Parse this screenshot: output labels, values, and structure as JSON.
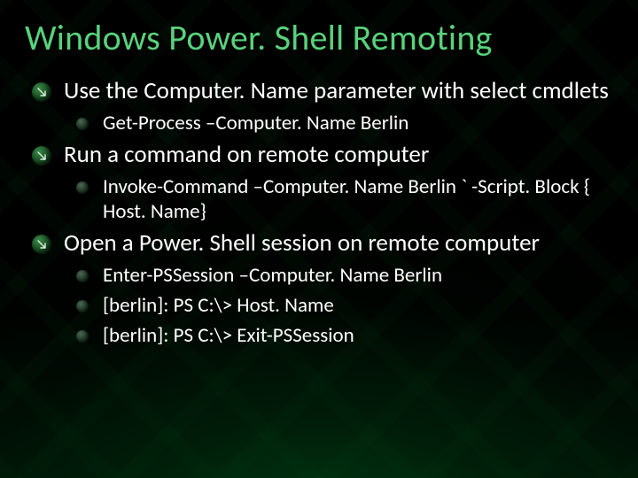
{
  "title": "Windows Power. Shell Remoting",
  "items": [
    {
      "level": 1,
      "text": "Use the Computer. Name parameter with select cmdlets"
    },
    {
      "level": 2,
      "text": "Get-Process –Computer. Name Berlin"
    },
    {
      "level": 1,
      "text": "Run a command on remote computer"
    },
    {
      "level": 2,
      "text": "Invoke-Command –Computer. Name Berlin ` -Script. Block { Host. Name}"
    },
    {
      "level": 1,
      "text": "Open a Power. Shell session on remote computer"
    },
    {
      "level": 2,
      "text": "Enter-PSSession –Computer. Name Berlin"
    },
    {
      "level": 2,
      "text": "[berlin]: PS C:\\>  Host. Name"
    },
    {
      "level": 2,
      "text": "[berlin]: PS C:\\> Exit-PSSession"
    }
  ]
}
